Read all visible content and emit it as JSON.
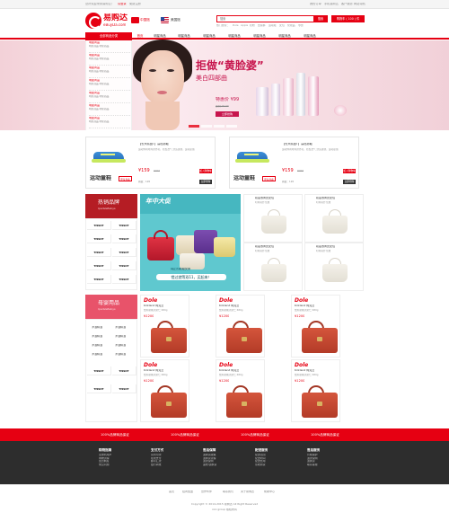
{
  "topbar": {
    "left_links": [
      "您好欢迎来到易购达！",
      "请登录",
      "免费注册"
    ],
    "right_links": [
      "我的订单",
      "手机易购达",
      "客户服务",
      "网站导航"
    ]
  },
  "header": {
    "logo_cn": "易购达",
    "logo_en": "eBuyDa.com",
    "region_cn": "中国馆",
    "region_us": "美国馆",
    "search_placeholder": "搜索",
    "search_button": "搜索",
    "cart_label": "购物车 ( 100 ) 件",
    "hotwords": [
      "热门搜索：",
      "Dole",
      "Apple",
      "奶粉",
      "纸尿裤",
      "运动鞋",
      "女包",
      "化妆品",
      "零食"
    ]
  },
  "nav": {
    "category_header": "全部商品分类",
    "items": [
      "首页",
      "明星商品",
      "明星商品",
      "明星商品",
      "明星商品",
      "明星商品",
      "明星商品",
      "明星商品"
    ]
  },
  "sidebar": {
    "items": [
      {
        "title": "明星商品",
        "sub": "明星商品 明星商品"
      },
      {
        "title": "明星商品",
        "sub": "明星商品 明星商品"
      },
      {
        "title": "明星商品",
        "sub": "明星商品 明星商品"
      },
      {
        "title": "明星商品",
        "sub": "明星商品 明星商品"
      },
      {
        "title": "明星商品",
        "sub": "明星商品 明星商品"
      },
      {
        "title": "明星商品",
        "sub": "明星商品 明星商品"
      },
      {
        "title": "明星商品",
        "sub": "明星商品 明星商品"
      }
    ]
  },
  "banner": {
    "title": "拒做“黄脸婆”",
    "subtitle": "美白四部曲",
    "price": "特惠价 ¥99",
    "old_price": "原价:¥199",
    "buy_button": "立即抢购"
  },
  "products": [
    {
      "title": "【长大精品T】高档男鞋",
      "desc": "运动休闲时尚款男鞋，轻盈透气 舒适柔软，运动必备",
      "price": "¥159",
      "old_price": "¥299",
      "add_cart": "加入购物车",
      "label": "运动童鞋",
      "label_btn": "更多查看",
      "sold": "销量：120",
      "buy": "立即抢购"
    },
    {
      "title": "【长大精品T】高档男鞋",
      "desc": "运动休闲时尚款男鞋，轻盈透气 舒适柔软，运动必备",
      "price": "¥159",
      "old_price": "¥299",
      "add_cart": "加入购物车",
      "label": "运动童鞋",
      "label_btn": "更多查看",
      "sold": "销量：120",
      "buy": "立即抢购"
    }
  ],
  "hot_brands": {
    "title": "热销品牌",
    "subtitle": "Ipads&Babys",
    "brands": [
      "TISSOT",
      "TISSOT",
      "TISSOT",
      "TISSOT",
      "TISSOT",
      "TISSOT",
      "TISSOT",
      "TISSOT",
      "TISSOT",
      "TISSOT"
    ]
  },
  "promo": {
    "top_text": "年中大促",
    "mid_text": "真正的超级女款",
    "bottom_text": "错过就等双11，买起来！"
  },
  "grid_items": [
    {
      "title": "初蕴浓黄皮女包",
      "sub": "时尚简约 优雅"
    },
    {
      "title": "初蕴浓黄皮女包",
      "sub": "时尚简约 优雅"
    },
    {
      "title": "初蕴浓黄皮女包",
      "sub": "时尚简约 优雅"
    },
    {
      "title": "初蕴浓黄皮女包",
      "sub": "时尚简约 优雅"
    }
  ],
  "mother_baby": {
    "title": "母婴用品",
    "subtitle": "Ipads&Babys",
    "list": [
      "洋酒精酒",
      "洋酒精酒",
      "洋酒精酒",
      "洋酒精酒",
      "洋酒精酒",
      "洋酒精酒",
      "洋酒精酒",
      "洋酒精酒"
    ],
    "brands": [
      "TISSOT",
      "TISSOT",
      "TISSOT",
      "TISSOT"
    ]
  },
  "dole_items": [
    {
      "logo": "Dole",
      "name": "Kirkland 柯克兰",
      "desc": "盐焗夏威夷果仁 680g",
      "price": "¥1200"
    },
    {
      "logo": "Dole",
      "name": "Kirkland 柯克兰",
      "desc": "盐焗夏威夷果仁 680g",
      "price": "¥1200"
    },
    {
      "logo": "Dole",
      "name": "Kirkland 柯克兰",
      "desc": "盐焗夏威夷果仁 680g",
      "price": "¥1200"
    },
    {
      "logo": "Dole",
      "name": "Kirkland 柯克兰",
      "desc": "盐焗夏威夷果仁 680g",
      "price": "¥1200"
    },
    {
      "logo": "Dole",
      "name": "Kirkland 柯克兰",
      "desc": "盐焗夏威夷果仁 680g",
      "price": "¥1200"
    },
    {
      "logo": "Dole",
      "name": "Kirkland 柯克兰",
      "desc": "盐焗夏威夷果仁 680g",
      "price": "¥1200"
    }
  ],
  "red_strip": [
    "100%品牌商品保证",
    "100%品牌商品保证",
    "100%品牌商品保证",
    "100%品牌商品保证"
  ],
  "footer": {
    "cols": [
      {
        "title": "购物指南",
        "items": [
          "注册新用户",
          "购物流程",
          "会员制度",
          "常见问题"
        ]
      },
      {
        "title": "支付方式",
        "items": [
          "货到付款",
          "在线支付",
          "邮局汇款",
          "银行转账"
        ]
      },
      {
        "title": "售后保障",
        "items": [
          "退换货政策",
          "退换货流程",
          "退款说明",
          "返修/退换货"
        ]
      },
      {
        "title": "配送服务",
        "items": [
          "配送范围",
          "配送时间",
          "配送费用",
          "签收验货"
        ]
      },
      {
        "title": "售后服务",
        "items": [
          "价格保护",
          "退款说明",
          "退换货",
          "联系客服"
        ]
      }
    ],
    "bottom_links": [
      "首页",
      "招商加盟",
      "合作伙伴",
      "联系我们",
      "关于易购达",
      "帮助中心"
    ],
    "copyright": "Copyright © 2014-2015 易购达 All Right Reserved",
    "company": "xxx group 版权所有"
  },
  "colors": {
    "accent": "#e60012",
    "footer_bg": "#2d2d2d",
    "banner_pink": "#f3d1d8"
  }
}
